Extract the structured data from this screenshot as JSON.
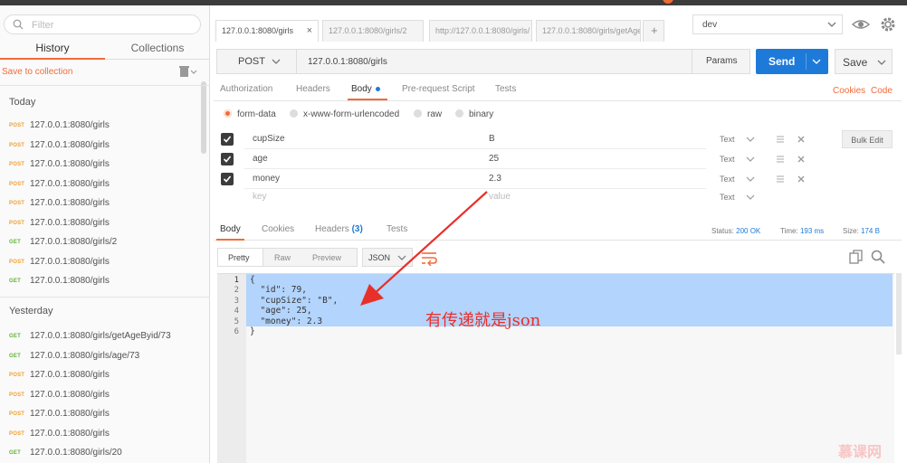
{
  "sidebar": {
    "search_placeholder": "Filter",
    "tabs": [
      "History",
      "Collections"
    ],
    "save_to_collection": "Save to collection",
    "today_label": "Today",
    "yesterday_label": "Yesterday",
    "today": [
      {
        "method": "POST",
        "url": "127.0.0.1:8080/girls"
      },
      {
        "method": "POST",
        "url": "127.0.0.1:8080/girls"
      },
      {
        "method": "POST",
        "url": "127.0.0.1:8080/girls"
      },
      {
        "method": "POST",
        "url": "127.0.0.1:8080/girls"
      },
      {
        "method": "POST",
        "url": "127.0.0.1:8080/girls"
      },
      {
        "method": "POST",
        "url": "127.0.0.1:8080/girls"
      },
      {
        "method": "GET",
        "url": "127.0.0.1:8080/girls/2"
      },
      {
        "method": "POST",
        "url": "127.0.0.1:8080/girls"
      },
      {
        "method": "GET",
        "url": "127.0.0.1:8080/girls"
      }
    ],
    "yesterday": [
      {
        "method": "GET",
        "url": "127.0.0.1:8080/girls/getAgeByid/73"
      },
      {
        "method": "GET",
        "url": "127.0.0.1:8080/girls/age/73"
      },
      {
        "method": "POST",
        "url": "127.0.0.1:8080/girls"
      },
      {
        "method": "POST",
        "url": "127.0.0.1:8080/girls"
      },
      {
        "method": "POST",
        "url": "127.0.0.1:8080/girls"
      },
      {
        "method": "POST",
        "url": "127.0.0.1:8080/girls"
      },
      {
        "method": "GET",
        "url": "127.0.0.1:8080/girls/20"
      }
    ]
  },
  "request_tabs": [
    {
      "label": "127.0.0.1:8080/girls",
      "close": "×"
    },
    {
      "label": "127.0.0.1:8080/girls/2"
    },
    {
      "label": "http://127.0.0.1:8080/girls/"
    },
    {
      "label": "127.0.0.1:8080/girls/getAge"
    },
    {
      "label": "+"
    }
  ],
  "environment": "dev",
  "request": {
    "method": "POST",
    "url": "127.0.0.1:8080/girls",
    "params_label": "Params",
    "send_label": "Send",
    "save_label": "Save"
  },
  "req_subtabs": [
    "Authorization",
    "Headers",
    "Body",
    "Pre-request Script",
    "Tests"
  ],
  "cookies_link": "Cookies",
  "code_link": "Code",
  "body_types": [
    "form-data",
    "x-www-form-urlencoded",
    "raw",
    "binary"
  ],
  "form_rows": [
    {
      "key": "cupSize",
      "value": "B",
      "type": "Text"
    },
    {
      "key": "age",
      "value": "25",
      "type": "Text"
    },
    {
      "key": "money",
      "value": "2.3",
      "type": "Text"
    }
  ],
  "placeholder_row": {
    "key": "key",
    "value": "value",
    "type": "Text"
  },
  "bulk_edit": "Bulk Edit",
  "response": {
    "tabs": {
      "body": "Body",
      "cookies": "Cookies",
      "headers": "Headers",
      "headers_count": "(3)",
      "tests": "Tests"
    },
    "status_label": "Status:",
    "status": "200 OK",
    "time_label": "Time:",
    "time": "193 ms",
    "size_label": "Size:",
    "size": "174 B",
    "formats": [
      "Pretty",
      "Raw",
      "Preview"
    ],
    "lang": "JSON",
    "lines": [
      "{",
      "  \"id\": 79,",
      "  \"cupSize\": \"B\",",
      "  \"age\": 25,",
      "  \"money\": 2.3",
      "}"
    ],
    "line_numbers": [
      "1",
      "2",
      "3",
      "4",
      "5",
      "6"
    ]
  },
  "annotation": "有传递就是json",
  "watermark": "慕课网",
  "colors": {
    "accent": "#f26b3a",
    "send": "#1e7ad9",
    "annotation": "#e8302b"
  }
}
